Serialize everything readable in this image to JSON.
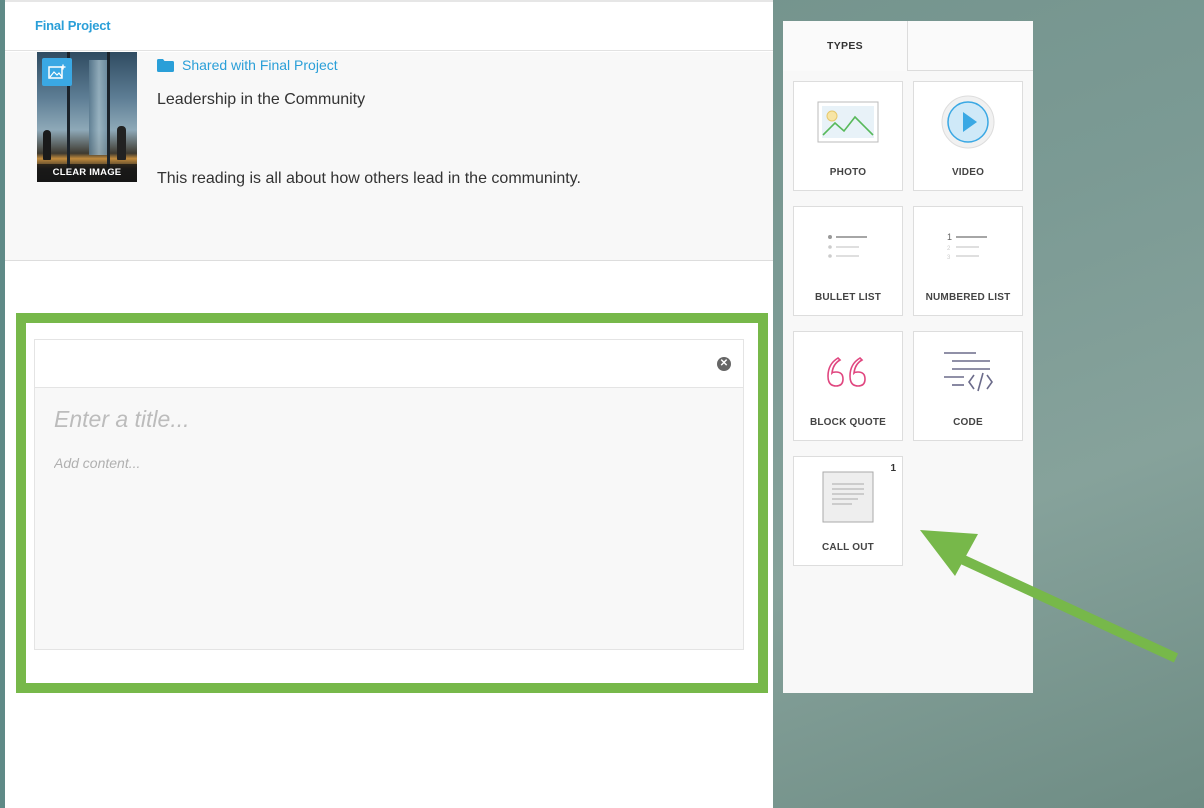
{
  "header": {
    "breadcrumb": "Final Project"
  },
  "card": {
    "image_action": "CLEAR IMAGE",
    "shared_label": "Shared with Final Project",
    "title": "Leadership in the Community",
    "description": "This reading is all about how others lead in the communinty."
  },
  "editor": {
    "title_placeholder": "Enter a title...",
    "content_placeholder": "Add content...",
    "close_icon": "close-icon"
  },
  "panel": {
    "tab_types": "TYPES",
    "types": [
      {
        "label": "PHOTO",
        "icon": "photo-icon"
      },
      {
        "label": "VIDEO",
        "icon": "video-icon"
      },
      {
        "label": "BULLET LIST",
        "icon": "bullet-list-icon"
      },
      {
        "label": "NUMBERED LIST",
        "icon": "numbered-list-icon"
      },
      {
        "label": "BLOCK QUOTE",
        "icon": "block-quote-icon"
      },
      {
        "label": "CODE",
        "icon": "code-icon"
      },
      {
        "label": "CALL OUT",
        "icon": "call-out-icon",
        "badge": "1"
      }
    ]
  },
  "colors": {
    "accent": "#2a9fd8",
    "highlight": "#77b84a",
    "quote": "#e0467f",
    "video": "#3aa8e4"
  }
}
